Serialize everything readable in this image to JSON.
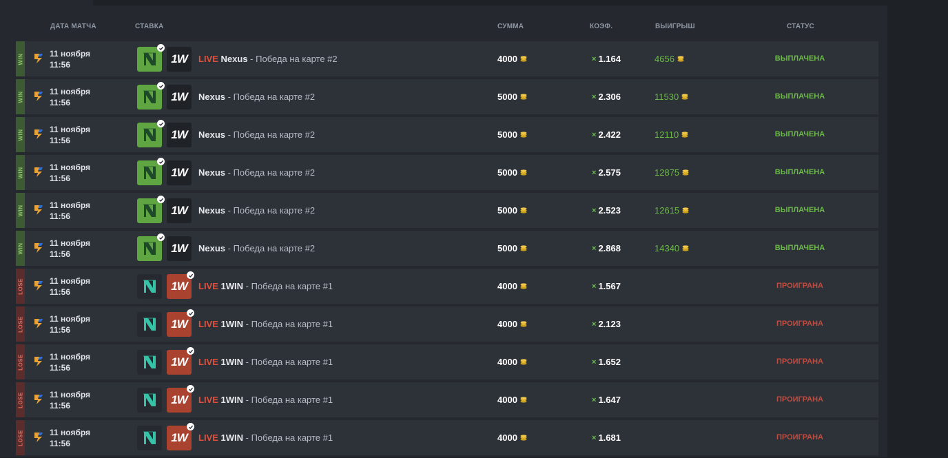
{
  "header": {
    "date": "ДАТА МАТЧА",
    "bet": "СТАВКА",
    "amount": "СУММА",
    "coef": "КОЭФ.",
    "payout": "ВЫИГРЫШ",
    "status": "СТАТУС"
  },
  "colors": {
    "win_badge": "#3d5b33",
    "lose_badge": "#5b2c2c",
    "win_text": "#6cb848",
    "lose_text": "#c24b3f",
    "live_text": "#e2503c"
  },
  "bets": [
    {
      "result": "WIN",
      "date": "11 ноября",
      "time": "11:56",
      "live": "LIVE",
      "team": "Nexus",
      "market": " - Победа на карте #2",
      "picked": "team1",
      "amount": "4000",
      "coef": "1.164",
      "payout": "4656",
      "status": "ВЫПЛАЧЕНА"
    },
    {
      "result": "WIN",
      "date": "11 ноября",
      "time": "11:56",
      "live": "",
      "team": "Nexus",
      "market": " - Победа на карте #2",
      "picked": "team1",
      "amount": "5000",
      "coef": "2.306",
      "payout": "11530",
      "status": "ВЫПЛАЧЕНА"
    },
    {
      "result": "WIN",
      "date": "11 ноября",
      "time": "11:56",
      "live": "",
      "team": "Nexus",
      "market": " - Победа на карте #2",
      "picked": "team1",
      "amount": "5000",
      "coef": "2.422",
      "payout": "12110",
      "status": "ВЫПЛАЧЕНА"
    },
    {
      "result": "WIN",
      "date": "11 ноября",
      "time": "11:56",
      "live": "",
      "team": "Nexus",
      "market": " - Победа на карте #2",
      "picked": "team1",
      "amount": "5000",
      "coef": "2.575",
      "payout": "12875",
      "status": "ВЫПЛАЧЕНА"
    },
    {
      "result": "WIN",
      "date": "11 ноября",
      "time": "11:56",
      "live": "",
      "team": "Nexus",
      "market": " - Победа на карте #2",
      "picked": "team1",
      "amount": "5000",
      "coef": "2.523",
      "payout": "12615",
      "status": "ВЫПЛАЧЕНА"
    },
    {
      "result": "WIN",
      "date": "11 ноября",
      "time": "11:56",
      "live": "",
      "team": "Nexus",
      "market": " - Победа на карте #2",
      "picked": "team1",
      "amount": "5000",
      "coef": "2.868",
      "payout": "14340",
      "status": "ВЫПЛАЧЕНА"
    },
    {
      "result": "LOSE",
      "date": "11 ноября",
      "time": "11:56",
      "live": "LIVE",
      "team": "1WIN",
      "market": " - Победа на карте #1",
      "picked": "team2",
      "amount": "4000",
      "coef": "1.567",
      "payout": "",
      "status": "ПРОИГРАНА"
    },
    {
      "result": "LOSE",
      "date": "11 ноября",
      "time": "11:56",
      "live": "LIVE",
      "team": "1WIN",
      "market": " - Победа на карте #1",
      "picked": "team2",
      "amount": "4000",
      "coef": "2.123",
      "payout": "",
      "status": "ПРОИГРАНА"
    },
    {
      "result": "LOSE",
      "date": "11 ноября",
      "time": "11:56",
      "live": "LIVE",
      "team": "1WIN",
      "market": " - Победа на карте #1",
      "picked": "team2",
      "amount": "4000",
      "coef": "1.652",
      "payout": "",
      "status": "ПРОИГРАНА"
    },
    {
      "result": "LOSE",
      "date": "11 ноября",
      "time": "11:56",
      "live": "LIVE",
      "team": "1WIN",
      "market": " - Победа на карте #1",
      "picked": "team2",
      "amount": "4000",
      "coef": "1.647",
      "payout": "",
      "status": "ПРОИГРАНА"
    },
    {
      "result": "LOSE",
      "date": "11 ноября",
      "time": "11:56",
      "live": "LIVE",
      "team": "1WIN",
      "market": " - Победа на карте #1",
      "picked": "team2",
      "amount": "4000",
      "coef": "1.681",
      "payout": "",
      "status": "ПРОИГРАНА"
    }
  ],
  "icons": {
    "game": "cs-game-icon",
    "team1": "nexus-logo-icon",
    "team2": "1win-logo-icon",
    "coin": "coin-icon",
    "check": "check-icon"
  },
  "logo_text_1w": "1W",
  "coef_prefix": "×"
}
